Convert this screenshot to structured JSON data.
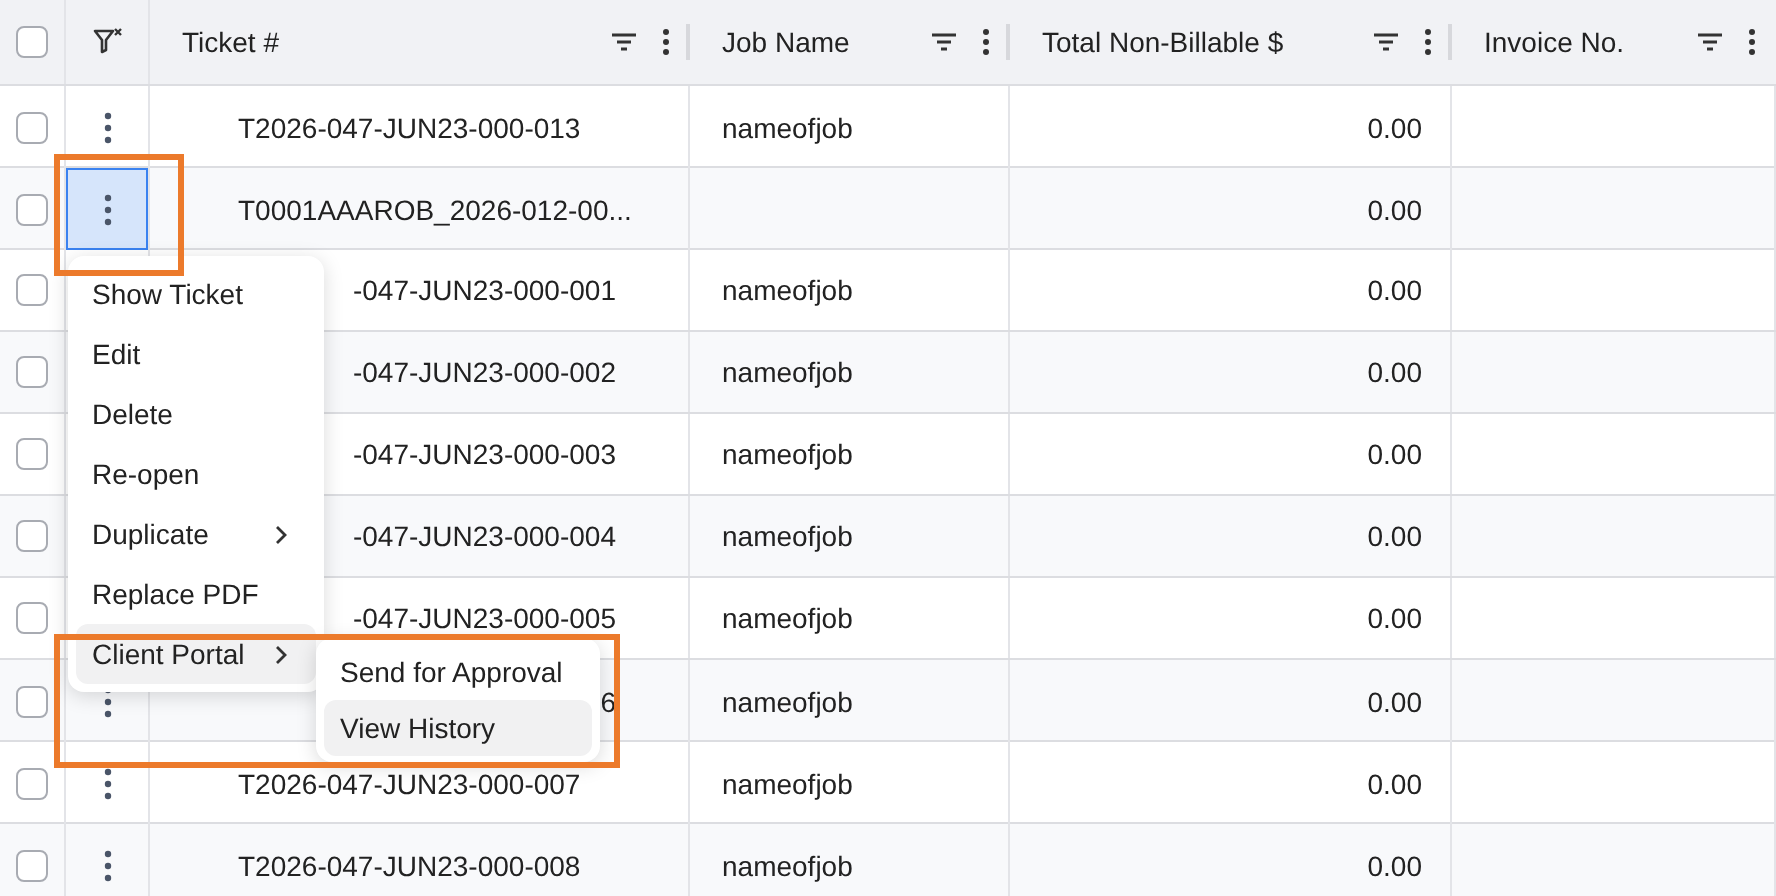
{
  "table": {
    "columns": [
      {
        "label": "Ticket #",
        "kind": "data"
      },
      {
        "label": "Job Name",
        "kind": "data"
      },
      {
        "label": "Total Non-Billable $",
        "kind": "data"
      },
      {
        "label": "Invoice No.",
        "kind": "data"
      }
    ],
    "all_checked": false,
    "rows": [
      {
        "ticket": "T2026-047-JUN23-000-013",
        "covered": false,
        "checked": false,
        "job": "nameofjob",
        "total": "0.00",
        "has_actions": true,
        "actions_selected": false
      },
      {
        "ticket": "T0001AAAROB_2026-012-00...",
        "covered": false,
        "checked": false,
        "total": "0.00",
        "has_actions": true,
        "actions_selected": true
      },
      {
        "ticket": "-047-JUN23-000-001",
        "covered": true,
        "checked": false,
        "job": "nameofjob",
        "total": "0.00"
      },
      {
        "ticket": "-047-JUN23-000-002",
        "covered": true,
        "checked": false,
        "job": "nameofjob",
        "total": "0.00"
      },
      {
        "ticket": "-047-JUN23-000-003",
        "covered": true,
        "checked": false,
        "job": "nameofjob",
        "total": "0.00"
      },
      {
        "ticket": "-047-JUN23-000-004",
        "covered": true,
        "checked": false,
        "job": "nameofjob",
        "total": "0.00"
      },
      {
        "ticket": "-047-JUN23-000-005",
        "covered": true,
        "checked": false,
        "job": "nameofjob",
        "total": "0.00"
      },
      {
        "ticket": "6",
        "covered": true,
        "checked": false,
        "job": "nameofjob",
        "total": "0.00",
        "has_actions": true,
        "actions_selected": false
      },
      {
        "ticket": "T2026-047-JUN23-000-007",
        "covered": false,
        "checked": false,
        "job": "nameofjob",
        "total": "0.00",
        "has_actions": true,
        "actions_selected": false
      },
      {
        "ticket": "T2026-047-JUN23-000-008",
        "covered": false,
        "checked": false,
        "job": "nameofjob",
        "total": "0.00",
        "has_actions": true,
        "actions_selected": false
      }
    ]
  },
  "context_menu": {
    "items": [
      {
        "label": "Show Ticket",
        "has_submenu": false,
        "highlighted": false
      },
      {
        "label": "Edit",
        "has_submenu": false,
        "highlighted": false
      },
      {
        "label": "Delete",
        "has_submenu": false,
        "highlighted": false
      },
      {
        "label": "Re-open",
        "has_submenu": false,
        "highlighted": false
      },
      {
        "label": "Duplicate",
        "has_submenu": true,
        "highlighted": false
      },
      {
        "label": "Replace PDF",
        "has_submenu": false,
        "highlighted": false
      },
      {
        "label": "Client Portal",
        "has_submenu": true,
        "highlighted": true
      }
    ]
  },
  "submenu": {
    "items": [
      {
        "label": "Send for Approval",
        "highlighted": false
      },
      {
        "label": "View History",
        "highlighted": true
      }
    ]
  }
}
